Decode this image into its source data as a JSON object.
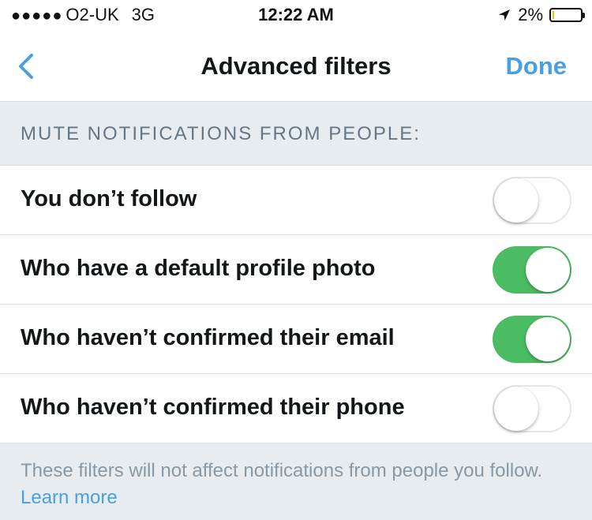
{
  "status_bar": {
    "signal_dots": "●●●●●",
    "carrier": "O2-UK",
    "network": "3G",
    "time": "12:22 AM",
    "battery_percent": "2%",
    "battery_level": 0.02
  },
  "nav": {
    "title": "Advanced filters",
    "done_label": "Done"
  },
  "section": {
    "header": "MUTE NOTIFICATIONS FROM PEOPLE:"
  },
  "rows": [
    {
      "label": "You don’t follow",
      "enabled": false
    },
    {
      "label": "Who have a default profile photo",
      "enabled": true
    },
    {
      "label": "Who haven’t confirmed their email",
      "enabled": true
    },
    {
      "label": "Who haven’t confirmed their phone",
      "enabled": false
    }
  ],
  "footer": {
    "text": "These filters will not affect notifications from people you follow.",
    "link": "Learn more"
  },
  "colors": {
    "accent": "#4a9fe0",
    "toggle_on": "#4cbc64",
    "section_bg": "#e7ecf0"
  }
}
